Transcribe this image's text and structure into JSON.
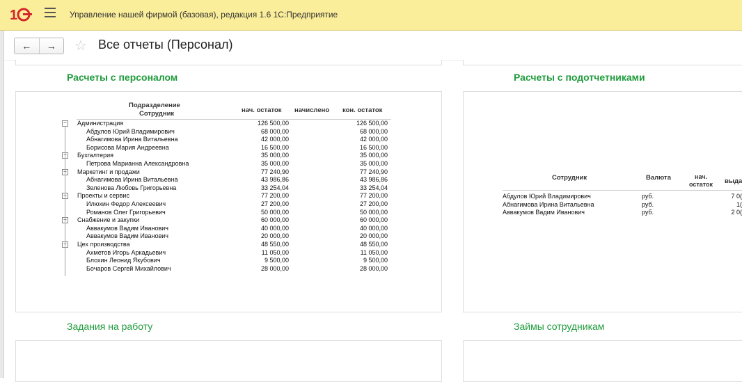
{
  "app": {
    "title": "Управление нашей фирмой (базовая), редакция 1.6 1С:Предприятие",
    "logo_text": "1С"
  },
  "nav": {
    "back": "←",
    "forward": "→",
    "page_title": "Все отчеты (Персонал)"
  },
  "sections": {
    "payroll": "Расчеты с персоналом",
    "accountable": "Расчеты с подотчетниками",
    "tasks": "Задания на работу",
    "loans": "Займы сотрудникам"
  },
  "payroll": {
    "headers": {
      "dept": "Подразделение",
      "employee": "Сотрудник",
      "start": "нач. остаток",
      "accrued": "начислено",
      "end": "кон. остаток"
    },
    "rows": [
      {
        "name": "Администрация",
        "start": "126 500,00",
        "end": "126 500,00",
        "group": true
      },
      {
        "name": "Абдулов Юрий Владимирович",
        "start": "68 000,00",
        "end": "68 000,00",
        "group": false
      },
      {
        "name": "Абнагимова Ирина Витальевна",
        "start": "42 000,00",
        "end": "42 000,00",
        "group": false
      },
      {
        "name": "Борисова Мария Андреевна",
        "start": "16 500,00",
        "end": "16 500,00",
        "group": false
      },
      {
        "name": "Бухгалтерия",
        "start": "35 000,00",
        "end": "35 000,00",
        "group": true
      },
      {
        "name": "Петрова Марианна Александровна",
        "start": "35 000,00",
        "end": "35 000,00",
        "group": false
      },
      {
        "name": "Маркетинг и продажи",
        "start": "77 240,90",
        "end": "77 240,90",
        "group": true
      },
      {
        "name": "Абнагимова Ирина Витальевна",
        "start": "43 986,86",
        "end": "43 986,86",
        "group": false
      },
      {
        "name": "Зеленова Любовь Григорьевна",
        "start": "33 254,04",
        "end": "33 254,04",
        "group": false
      },
      {
        "name": "Проекты и сервис",
        "start": "77 200,00",
        "end": "77 200,00",
        "group": true
      },
      {
        "name": "Илюхин Федор Алексеевич",
        "start": "27 200,00",
        "end": "27 200,00",
        "group": false
      },
      {
        "name": "Романов Олег Григорьевич",
        "start": "50 000,00",
        "end": "50 000,00",
        "group": false
      },
      {
        "name": "Снабжение и закупки",
        "start": "60 000,00",
        "end": "60 000,00",
        "group": true
      },
      {
        "name": "Аввакумов Вадим Иванович",
        "start": "40 000,00",
        "end": "40 000,00",
        "group": false
      },
      {
        "name": "Аввакумов Вадим Иванович",
        "start": "20 000,00",
        "end": "20 000,00",
        "group": false
      },
      {
        "name": "Цех производства",
        "start": "48 550,00",
        "end": "48 550,00",
        "group": true
      },
      {
        "name": "Ахметов Игорь Аркадьевич",
        "start": "11 050,00",
        "end": "11 050,00",
        "group": false
      },
      {
        "name": "Блохин Леонид Якубович",
        "start": "9 500,00",
        "end": "9 500,00",
        "group": false
      },
      {
        "name": "Бочаров Сергей Михайлович",
        "start": "28 000,00",
        "end": "28 000,00",
        "group": false
      }
    ]
  },
  "accountable": {
    "headers": {
      "employee": "Сотрудник",
      "currency": "Валюта",
      "start": "нач. остаток",
      "issued": "выда"
    },
    "rows": [
      {
        "name": "Абдулов Юрий Владимирович",
        "currency": "руб.",
        "issued": "7 0("
      },
      {
        "name": "Абнагимова Ирина Витальевна",
        "currency": "руб.",
        "issued": "1("
      },
      {
        "name": "Аввакумов Вадим Иванович",
        "currency": "руб.",
        "issued": "2 0("
      }
    ]
  }
}
